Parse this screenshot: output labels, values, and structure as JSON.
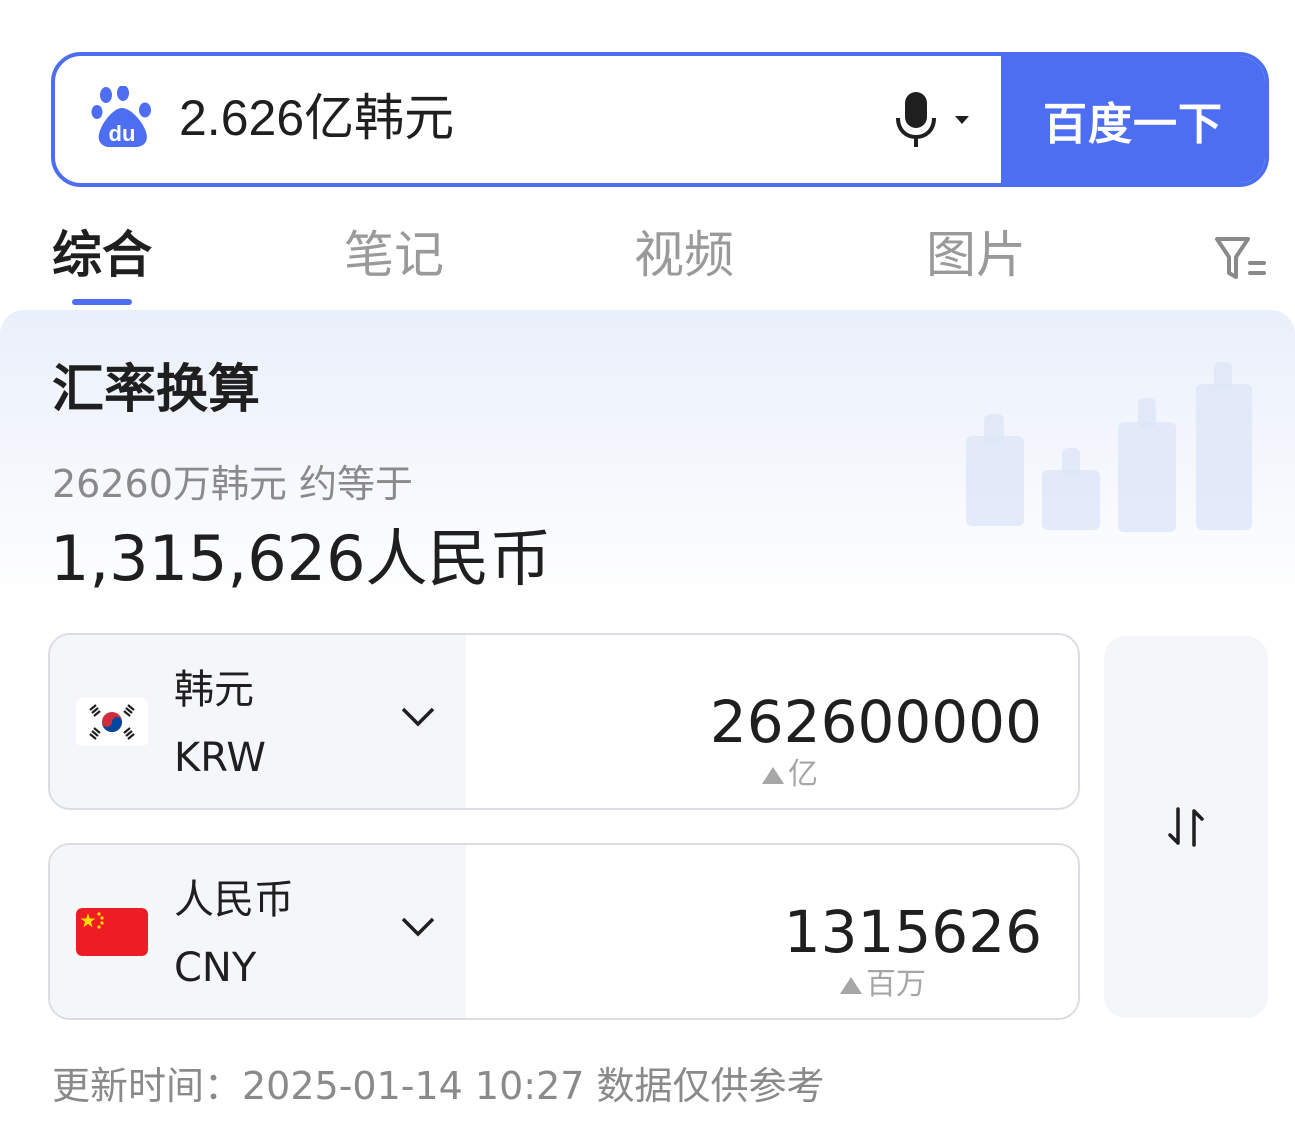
{
  "search": {
    "query": "2.626亿韩元",
    "button_label": "百度一下",
    "logo_icon": "baidu-paw-icon",
    "mic_icon": "microphone-icon",
    "accent_color": "#4e6ef2"
  },
  "tabs": [
    {
      "label": "综合",
      "active": true
    },
    {
      "label": "笔记",
      "active": false
    },
    {
      "label": "视频",
      "active": false
    },
    {
      "label": "图片",
      "active": false
    }
  ],
  "filter_icon": "filter-icon",
  "card": {
    "title": "汇率换算",
    "subtitle": "26260万韩元 约等于",
    "result": "1,315,626人民币"
  },
  "from_currency": {
    "name": "韩元",
    "code": "KRW",
    "flag": "south-korea-flag-icon",
    "amount": "262600000",
    "unit_hint": "亿"
  },
  "to_currency": {
    "name": "人民币",
    "code": "CNY",
    "flag": "china-flag-icon",
    "amount": "1315626",
    "unit_hint": "百万"
  },
  "swap_icon": "swap-arrows-icon",
  "update_text": "更新时间：2025-01-14 10:27 数据仅供参考"
}
